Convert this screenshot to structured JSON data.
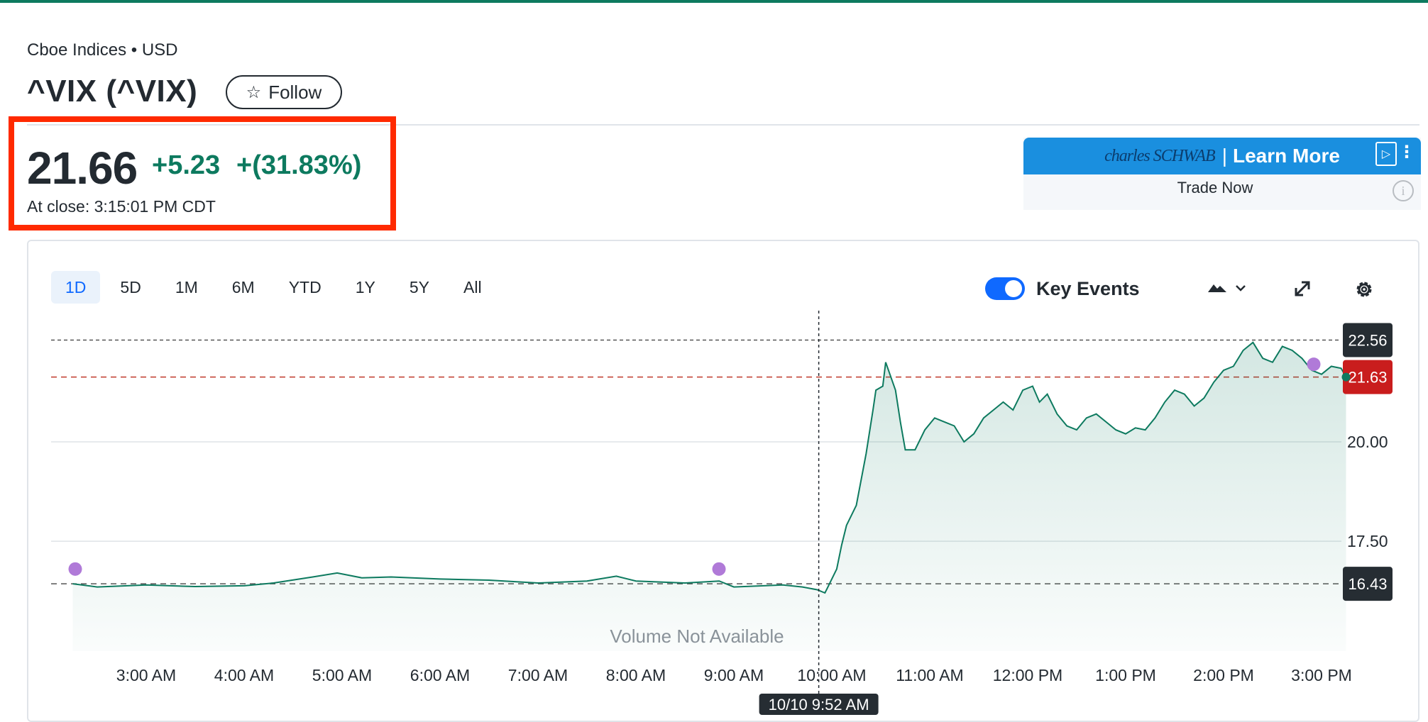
{
  "header": {
    "exchange": "Cboe Indices • USD",
    "ticker": "^VIX (^VIX)",
    "follow_label": "Follow"
  },
  "quote": {
    "price": "21.66",
    "change": "+5.23",
    "change_percent": "+(31.83%)",
    "close_time": "At close: 3:15:01 PM CDT"
  },
  "ad": {
    "brand": "charles SCHWAB",
    "cta": "Learn More",
    "subtitle": "Trade Now"
  },
  "range_tabs": [
    {
      "label": "1D",
      "active": true
    },
    {
      "label": "5D"
    },
    {
      "label": "1M"
    },
    {
      "label": "6M"
    },
    {
      "label": "YTD"
    },
    {
      "label": "1Y"
    },
    {
      "label": "5Y"
    },
    {
      "label": "All"
    }
  ],
  "controls": {
    "key_events_label": "Key Events",
    "key_events_on": true,
    "chart_type_icon": "mountain-icon",
    "expand_icon": "expand-icon",
    "settings_icon": "gear-icon"
  },
  "colors": {
    "accent": "#0d7a5f",
    "price_up": "#0d7a5f",
    "toggle": "#0f69ff",
    "highlight_box": "#ff2a00",
    "current_tag": "#c91d1d",
    "tag_dark": "#262d33",
    "event_dot": "#b07ad8"
  },
  "chart_data": {
    "type": "area",
    "x_ticks": [
      "3:00 AM",
      "4:00 AM",
      "5:00 AM",
      "6:00 AM",
      "7:00 AM",
      "8:00 AM",
      "9:00 AM",
      "10:00 AM",
      "11:00 AM",
      "12:00 PM",
      "1:00 PM",
      "2:00 PM",
      "3:00 PM"
    ],
    "y_ticks": [
      "20.00",
      "17.50"
    ],
    "ylim": [
      15.7,
      22.8
    ],
    "volume_note": "Volume Not Available",
    "crosshair_label": "10/10 9:52 AM",
    "reference_lines": {
      "day_high": {
        "label": "22.56",
        "value": 22.56
      },
      "current": {
        "label": "21.63",
        "value": 21.63
      },
      "previous_close": {
        "label": "16.43",
        "value": 16.43
      }
    },
    "series": [
      {
        "x": [
          2.25,
          2.5,
          3.0,
          3.5,
          4.0,
          4.3,
          4.7,
          4.95,
          5.2,
          5.5,
          6.0,
          6.5,
          7.0,
          7.5,
          7.8,
          8.0,
          8.5,
          8.85,
          9.0,
          9.5,
          9.7,
          9.85,
          9.93,
          9.95,
          10.05,
          10.1,
          10.15,
          10.25,
          10.35,
          10.42,
          10.45,
          10.52,
          10.55,
          10.65,
          10.7,
          10.75,
          10.85,
          10.95,
          11.05,
          11.15,
          11.25,
          11.35,
          11.45,
          11.55,
          11.65,
          11.75,
          11.85,
          11.95,
          12.05,
          12.12,
          12.2,
          12.3,
          12.4,
          12.5,
          12.6,
          12.7,
          12.8,
          12.9,
          13.0,
          13.1,
          13.2,
          13.3,
          13.4,
          13.5,
          13.6,
          13.7,
          13.8,
          13.9,
          14.0,
          14.1,
          14.2,
          14.3,
          14.4,
          14.5,
          14.6,
          14.7,
          14.8,
          14.9,
          15.0,
          15.1,
          15.2,
          15.25
        ],
        "y": [
          16.43,
          16.35,
          16.4,
          16.36,
          16.38,
          16.45,
          16.6,
          16.7,
          16.58,
          16.6,
          16.55,
          16.52,
          16.45,
          16.5,
          16.62,
          16.5,
          16.45,
          16.5,
          16.35,
          16.4,
          16.35,
          16.28,
          16.2,
          16.3,
          16.8,
          17.4,
          17.9,
          18.4,
          19.7,
          20.8,
          21.3,
          21.4,
          22.0,
          21.3,
          20.5,
          19.8,
          19.8,
          20.3,
          20.6,
          20.5,
          20.4,
          20.0,
          20.2,
          20.6,
          20.8,
          21.0,
          20.8,
          21.3,
          21.4,
          21.0,
          21.2,
          20.7,
          20.4,
          20.3,
          20.6,
          20.7,
          20.5,
          20.3,
          20.2,
          20.35,
          20.3,
          20.6,
          21.0,
          21.3,
          21.2,
          20.9,
          21.1,
          21.5,
          21.8,
          21.9,
          22.3,
          22.5,
          22.1,
          22.0,
          22.4,
          22.3,
          22.1,
          21.8,
          21.7,
          21.9,
          21.85,
          21.63
        ]
      }
    ]
  }
}
